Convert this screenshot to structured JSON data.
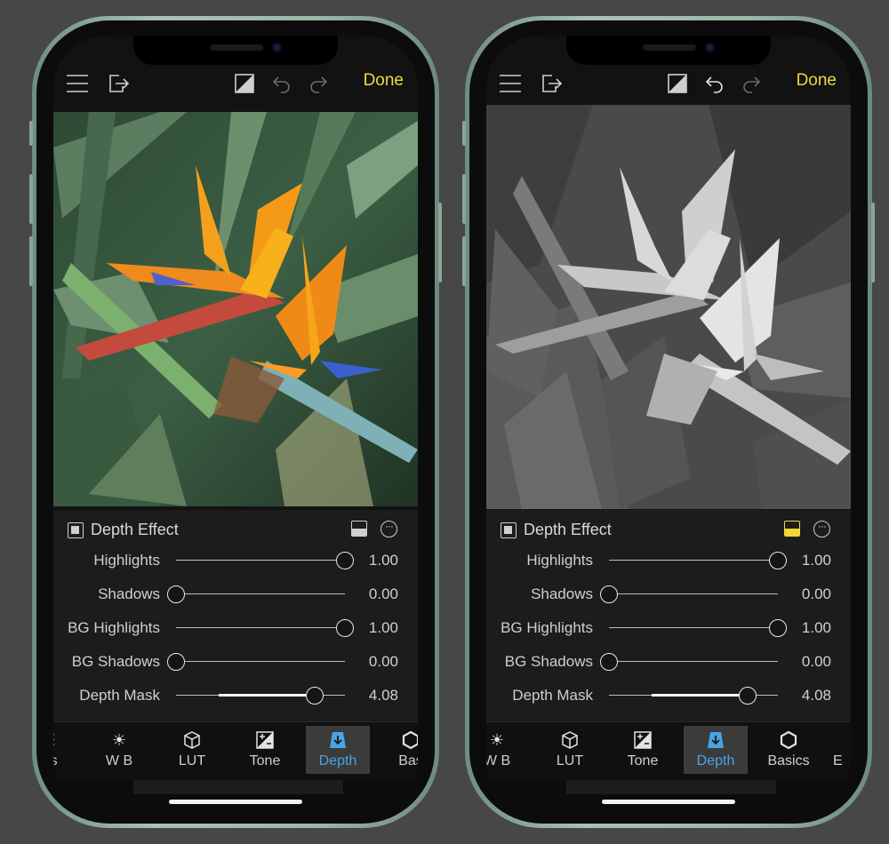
{
  "colors": {
    "accent": "#f2d73b",
    "active_tab": "#4aa3e6",
    "frame": "#9db7a7"
  },
  "phones": [
    {
      "id": "left",
      "topbar": {
        "menu_icon": "hamburger-menu-icon",
        "export_icon": "export-icon",
        "compare_icon": "compare-icon",
        "undo_icon": "undo-icon",
        "redo_icon": "redo-icon",
        "done_label": "Done"
      },
      "photo": {
        "mode": "color"
      },
      "panel": {
        "title": "Depth Effect",
        "mask_active": false,
        "sliders": [
          {
            "label": "Highlights",
            "value": "1.00",
            "fraction": 1.0
          },
          {
            "label": "Shadows",
            "value": "0.00",
            "fraction": 0.0
          },
          {
            "label": "BG Highlights",
            "value": "1.00",
            "fraction": 1.0
          },
          {
            "label": "BG Shadows",
            "value": "0.00",
            "fraction": 0.0
          },
          {
            "label": "Depth Mask",
            "value": "4.08",
            "fraction": 0.82,
            "range_start": 0.25
          }
        ]
      },
      "tabs": [
        {
          "label": "ets",
          "icon": "presets-icon"
        },
        {
          "label": "W B",
          "icon": "sun-icon"
        },
        {
          "label": "LUT",
          "icon": "cube-icon"
        },
        {
          "label": "Tone",
          "icon": "tone-icon"
        },
        {
          "label": "Depth",
          "icon": "depth-icon",
          "active": true
        },
        {
          "label": "Bas",
          "icon": "hexagon-icon"
        }
      ]
    },
    {
      "id": "right",
      "topbar": {
        "menu_icon": "hamburger-menu-icon",
        "export_icon": "export-icon",
        "compare_icon": "compare-icon",
        "undo_icon": "undo-icon",
        "redo_icon": "redo-icon",
        "done_label": "Done"
      },
      "photo": {
        "mode": "depth-map"
      },
      "panel": {
        "title": "Depth Effect",
        "mask_active": true,
        "sliders": [
          {
            "label": "Highlights",
            "value": "1.00",
            "fraction": 1.0
          },
          {
            "label": "Shadows",
            "value": "0.00",
            "fraction": 0.0
          },
          {
            "label": "BG Highlights",
            "value": "1.00",
            "fraction": 1.0
          },
          {
            "label": "BG Shadows",
            "value": "0.00",
            "fraction": 0.0
          },
          {
            "label": "Depth Mask",
            "value": "4.08",
            "fraction": 0.82,
            "range_start": 0.25
          }
        ]
      },
      "tabs": [
        {
          "label": "W B",
          "icon": "sun-icon"
        },
        {
          "label": "LUT",
          "icon": "cube-icon"
        },
        {
          "label": "Tone",
          "icon": "tone-icon"
        },
        {
          "label": "Depth",
          "icon": "depth-icon",
          "active": true
        },
        {
          "label": "Basics",
          "icon": "hexagon-icon"
        },
        {
          "label": "E",
          "icon": "effects-icon"
        }
      ]
    }
  ]
}
